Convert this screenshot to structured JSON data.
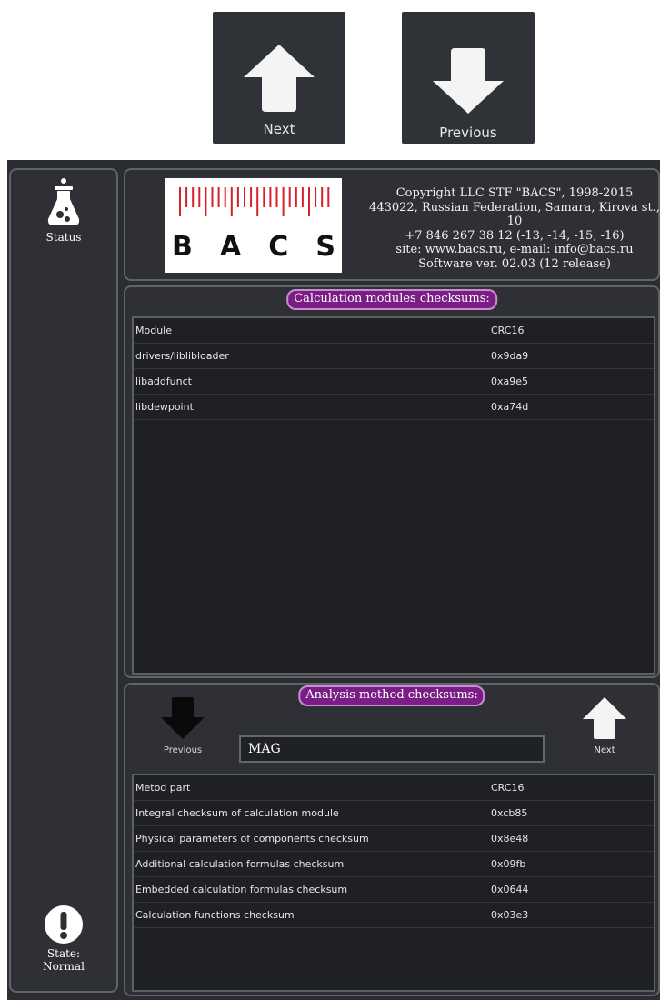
{
  "top_nav": {
    "next_label": "Next",
    "previous_label": "Previous"
  },
  "sidebar": {
    "status_label": "Status",
    "state_label_line1": "State:",
    "state_label_line2": "Normal"
  },
  "header": {
    "logo_letters": [
      "B",
      "A",
      "C",
      "S"
    ],
    "copyright_lines": [
      "Copyright LLC STF \"BACS\", 1998-2015",
      "443022, Russian Federation, Samara, Kirova st., 10",
      "+7 846 267 38 12 (-13, -14, -15, -16)",
      "site: www.bacs.ru, e-mail: info@bacs.ru",
      "Software ver. 02.03 (12 release)"
    ]
  },
  "calc_modules": {
    "title": "Calculation modules checksums:",
    "header": [
      "Module",
      "CRC16"
    ],
    "rows": [
      [
        "drivers/liblibloader",
        "0x9da9"
      ],
      [
        "libaddfunct",
        "0xa9e5"
      ],
      [
        "libdewpoint",
        "0xa74d"
      ]
    ]
  },
  "analysis_method": {
    "title": "Analysis method checksums:",
    "previous_label": "Previous",
    "next_label": "Next",
    "method_value": "MAG",
    "header": [
      "Metod part",
      "CRC16"
    ],
    "rows": [
      [
        "Integral checksum of calculation module",
        "0xcb85"
      ],
      [
        "Physical parameters of components checksum",
        "0x8e48"
      ],
      [
        "Additional calculation formulas checksum",
        "0x09fb"
      ],
      [
        "Embedded calculation formulas checksum",
        "0x0644"
      ],
      [
        "Calculation functions checksum",
        "0x03e3"
      ]
    ]
  },
  "colors": {
    "accent_pill": "#7a1e86",
    "logo_ticks": "#d9202a",
    "background": "#2b2d31"
  }
}
